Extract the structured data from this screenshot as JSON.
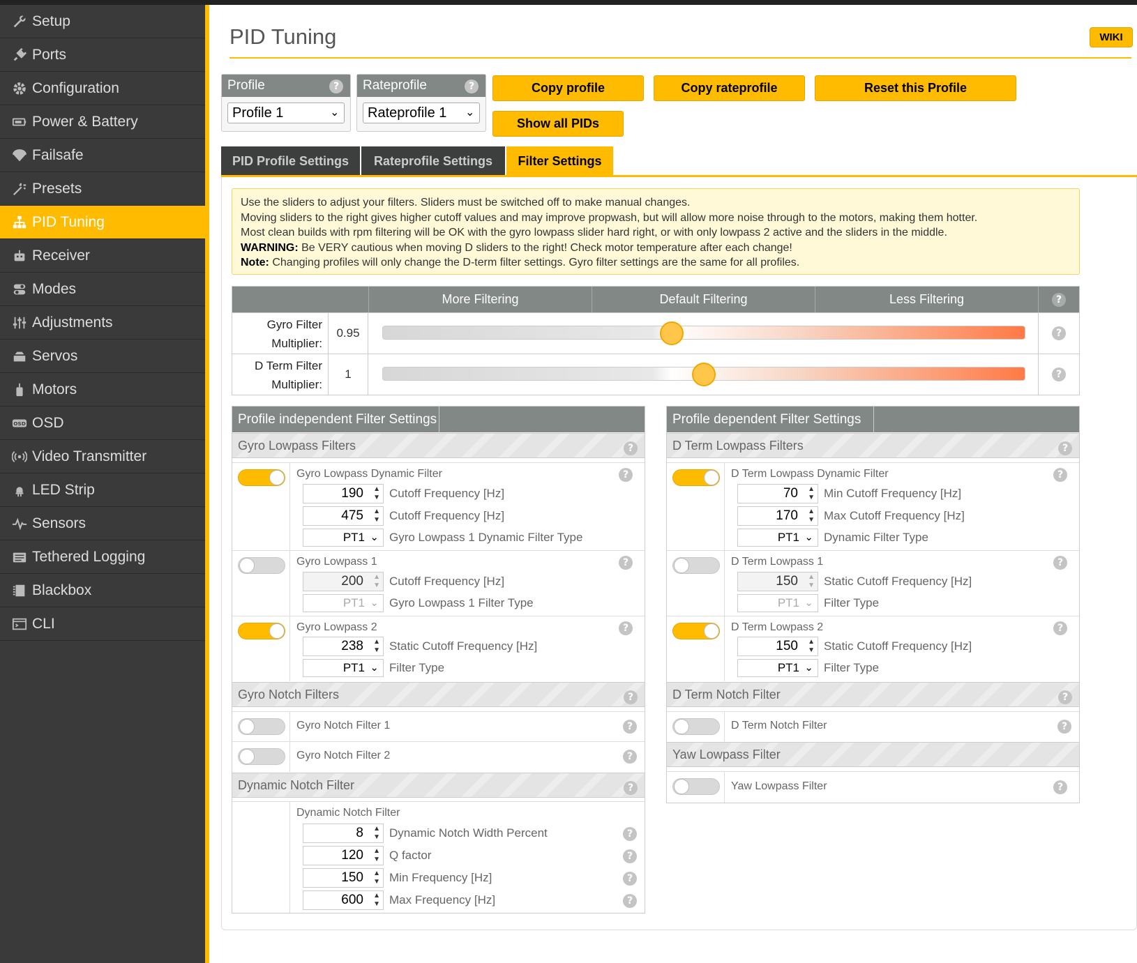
{
  "sidebar": {
    "items": [
      {
        "label": "Setup",
        "icon": "wrench-icon"
      },
      {
        "label": "Ports",
        "icon": "plug-icon"
      },
      {
        "label": "Configuration",
        "icon": "gear-icon"
      },
      {
        "label": "Power & Battery",
        "icon": "battery-icon"
      },
      {
        "label": "Failsafe",
        "icon": "parachute-icon"
      },
      {
        "label": "Presets",
        "icon": "magic-wand-icon"
      },
      {
        "label": "PID Tuning",
        "icon": "sitemap-icon"
      },
      {
        "label": "Receiver",
        "icon": "robot-icon"
      },
      {
        "label": "Modes",
        "icon": "toggle-icon"
      },
      {
        "label": "Adjustments",
        "icon": "sliders-icon"
      },
      {
        "label": "Servos",
        "icon": "servo-icon"
      },
      {
        "label": "Motors",
        "icon": "motor-icon"
      },
      {
        "label": "OSD",
        "icon": "osd-icon"
      },
      {
        "label": "Video Transmitter",
        "icon": "broadcast-icon"
      },
      {
        "label": "LED Strip",
        "icon": "led-icon"
      },
      {
        "label": "Sensors",
        "icon": "pulse-icon"
      },
      {
        "label": "Tethered Logging",
        "icon": "log-icon"
      },
      {
        "label": "Blackbox",
        "icon": "blackbox-icon"
      },
      {
        "label": "CLI",
        "icon": "terminal-icon"
      }
    ],
    "active": "PID Tuning",
    "accent_color": "#ffbb00"
  },
  "header": {
    "title": "PID Tuning",
    "wiki": "WIKI"
  },
  "profile": {
    "label": "Profile",
    "selected": "Profile 1"
  },
  "rateprofile": {
    "label": "Rateprofile",
    "selected": "Rateprofile 1"
  },
  "buttons": {
    "copy_profile": "Copy profile",
    "copy_rateprofile": "Copy rateprofile",
    "reset_profile": "Reset this Profile",
    "show_all_pids": "Show all PIDs"
  },
  "tabs": [
    {
      "label": "PID Profile Settings",
      "active": false
    },
    {
      "label": "Rateprofile Settings",
      "active": false
    },
    {
      "label": "Filter Settings",
      "active": true
    }
  ],
  "note": {
    "line1": "Use the sliders to adjust your filters. Sliders must be switched off to make manual changes.",
    "line2": "Moving sliders to the right gives higher cutoff values and may improve propwash, but will allow more noise through to the motors, making them hotter.",
    "line3": "Most clean builds with rpm filtering will be OK with the gyro lowpass slider hard right, or with only lowpass 2 active and the sliders in the middle.",
    "warning_label": "WARNING:",
    "warning_text": " Be VERY cautious when moving D sliders to the right! Check motor temperature after each change!",
    "note_label": "Note:",
    "note_text": " Changing profiles will only change the D-term filter settings. Gyro filter settings are the same for all profiles."
  },
  "sliders": {
    "headers": [
      "More Filtering",
      "Default Filtering",
      "Less Filtering"
    ],
    "gyro": {
      "label1": "Gyro Filter",
      "label2": "Multiplier:",
      "value": "0.95",
      "position": 0.45
    },
    "dterm": {
      "label1": "D Term Filter",
      "label2": "Multiplier:",
      "value": "1",
      "position": 0.5
    }
  },
  "left_panel": {
    "title": "Profile independent Filter Settings",
    "gyro_lowpass_header": "Gyro Lowpass Filters",
    "dyn": {
      "title": "Gyro Lowpass Dynamic Filter",
      "enabled": true,
      "min": "190",
      "min_label": "Cutoff Frequency [Hz]",
      "max": "475",
      "max_label": "Cutoff Frequency [Hz]",
      "type": "PT1",
      "type_label": "Gyro Lowpass 1 Dynamic Filter Type"
    },
    "lp1": {
      "title": "Gyro Lowpass 1",
      "enabled": false,
      "cutoff": "200",
      "cutoff_label": "Cutoff Frequency [Hz]",
      "type": "PT1",
      "type_label": "Gyro Lowpass 1 Filter Type"
    },
    "lp2": {
      "title": "Gyro Lowpass 2",
      "enabled": true,
      "cutoff": "238",
      "cutoff_label": "Static Cutoff Frequency [Hz]",
      "type": "PT1",
      "type_label": "Filter Type"
    },
    "notch_header": "Gyro Notch Filters",
    "notch1": {
      "title": "Gyro Notch Filter 1",
      "enabled": false
    },
    "notch2": {
      "title": "Gyro Notch Filter 2",
      "enabled": false
    },
    "dyn_notch_header": "Dynamic Notch Filter",
    "dyn_notch": {
      "title": "Dynamic Notch Filter",
      "width": "8",
      "width_label": "Dynamic Notch Width Percent",
      "q": "120",
      "q_label": "Q factor",
      "min": "150",
      "min_label": "Min Frequency [Hz]",
      "max": "600",
      "max_label": "Max Frequency [Hz]"
    }
  },
  "right_panel": {
    "title": "Profile dependent Filter Settings",
    "dterm_lowpass_header": "D Term Lowpass Filters",
    "dyn": {
      "title": "D Term Lowpass Dynamic Filter",
      "enabled": true,
      "min": "70",
      "min_label": "Min Cutoff Frequency [Hz]",
      "max": "170",
      "max_label": "Max Cutoff Frequency [Hz]",
      "type": "PT1",
      "type_label": "Dynamic Filter Type"
    },
    "lp1": {
      "title": "D Term Lowpass 1",
      "enabled": false,
      "cutoff": "150",
      "cutoff_label": "Static Cutoff Frequency [Hz]",
      "type": "PT1",
      "type_label": "Filter Type"
    },
    "lp2": {
      "title": "D Term Lowpass 2",
      "enabled": true,
      "cutoff": "150",
      "cutoff_label": "Static Cutoff Frequency [Hz]",
      "type": "PT1",
      "type_label": "Filter Type"
    },
    "notch_header": "D Term Notch Filter",
    "notch": {
      "title": "D Term Notch Filter",
      "enabled": false
    },
    "yaw_header": "Yaw Lowpass Filter",
    "yaw": {
      "title": "Yaw Lowpass Filter",
      "enabled": false
    }
  },
  "help_symbol": "?"
}
